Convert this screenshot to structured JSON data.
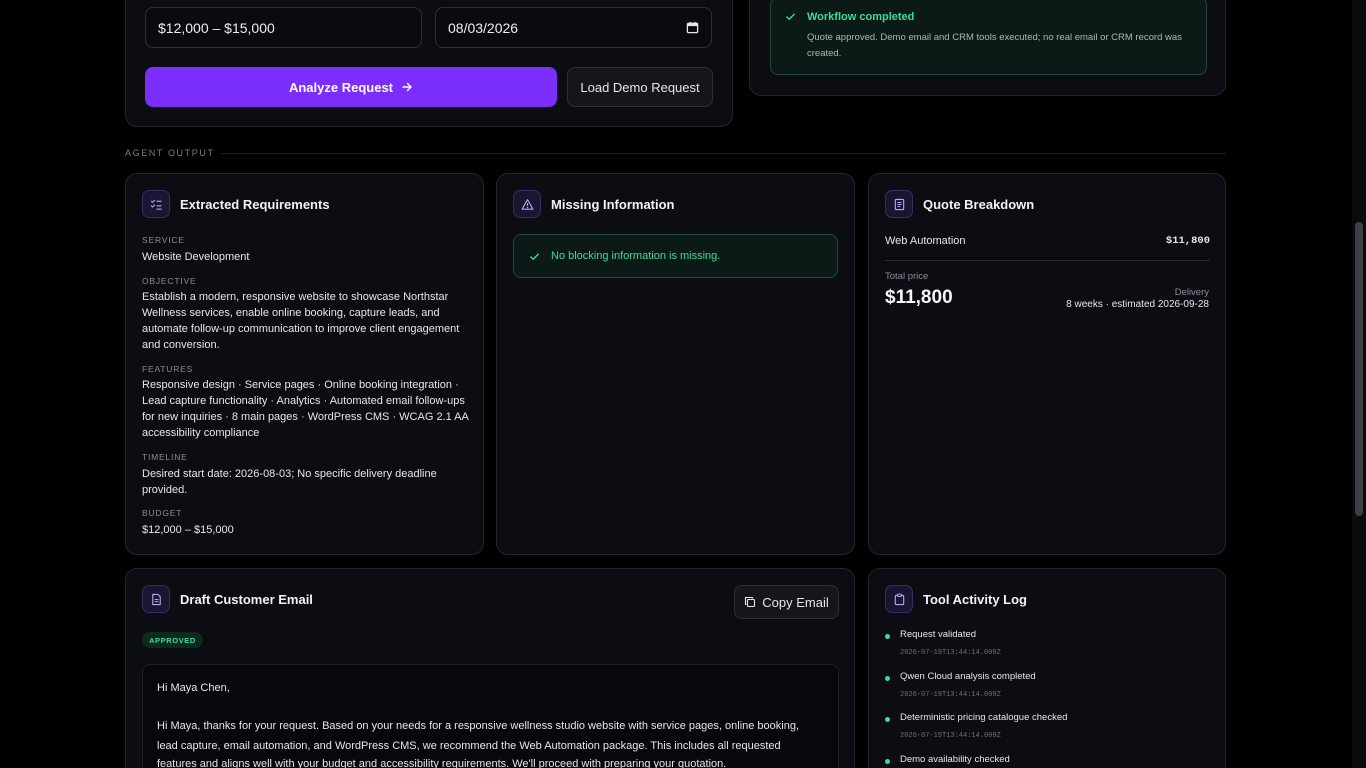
{
  "form": {
    "budget_value": "$12,000 – $15,000",
    "date_value": "08/03/2026",
    "analyze_label": "Analyze Request",
    "demo_label": "Load Demo Request"
  },
  "status": {
    "title": "Workflow completed",
    "message": "Quote approved. Demo email and CRM tools executed; no real email or CRM record was created."
  },
  "section_label": "AGENT OUTPUT",
  "requirements": {
    "title": "Extracted Requirements",
    "fields": [
      {
        "label": "SERVICE",
        "value": "Website Development"
      },
      {
        "label": "OBJECTIVE",
        "value": "Establish a modern, responsive website to showcase Northstar Wellness services, enable online booking, capture leads, and automate follow-up communication to improve client engagement and conversion."
      },
      {
        "label": "FEATURES",
        "value": "Responsive design · Service pages · Online booking integration · Lead capture functionality · Analytics · Automated email follow-ups for new inquiries · 8 main pages · WordPress CMS · WCAG 2.1 AA accessibility compliance"
      },
      {
        "label": "TIMELINE",
        "value": "Desired start date: 2026-08-03; No specific delivery deadline provided."
      },
      {
        "label": "BUDGET",
        "value": "$12,000 – $15,000"
      }
    ]
  },
  "missing": {
    "title": "Missing Information",
    "message": "No blocking information is missing."
  },
  "quote": {
    "title": "Quote Breakdown",
    "item_name": "Web Automation",
    "item_price": "$11,800",
    "total_label": "Total price",
    "total_value": "$11,800",
    "delivery_label": "Delivery",
    "delivery_value": "8 weeks · estimated 2026-09-28"
  },
  "email": {
    "title": "Draft Customer Email",
    "copy_label": "Copy Email",
    "badge": "APPROVED",
    "greeting": "Hi Maya Chen,",
    "body_line1": "Hi Maya, thanks for your request. Based on your needs for a responsive wellness studio website with service pages, online booking,",
    "body_line2": "lead capture, email automation, and WordPress CMS, we recommend the Web Automation package. This includes all requested",
    "body_line3": "features and aligns well with your budget and accessibility requirements. We'll proceed with preparing your quotation."
  },
  "log": {
    "title": "Tool Activity Log",
    "entries": [
      {
        "text": "Request validated",
        "time": "2026-07-19T13:44:14.009Z"
      },
      {
        "text": "Qwen Cloud analysis completed",
        "time": "2026-07-19T13:44:14.009Z"
      },
      {
        "text": "Deterministic pricing catalogue checked",
        "time": "2026-07-19T13:44:14.009Z"
      },
      {
        "text": "Demo availability checked",
        "time": ""
      }
    ]
  },
  "colors": {
    "accent": "#7b2dfa",
    "success": "#3ddc97",
    "background": "#000000"
  }
}
